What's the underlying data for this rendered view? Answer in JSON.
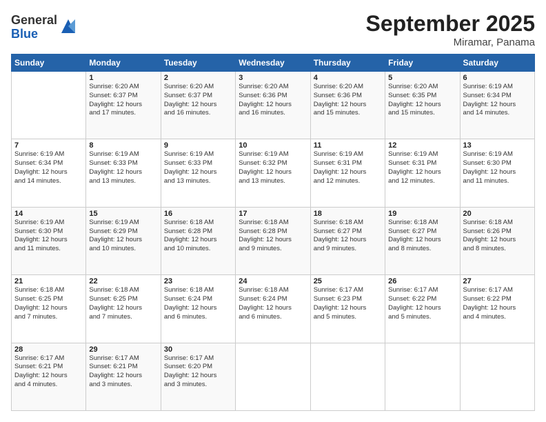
{
  "logo": {
    "general": "General",
    "blue": "Blue"
  },
  "header": {
    "month": "September 2025",
    "location": "Miramar, Panama"
  },
  "weekdays": [
    "Sunday",
    "Monday",
    "Tuesday",
    "Wednesday",
    "Thursday",
    "Friday",
    "Saturday"
  ],
  "weeks": [
    [
      {
        "num": "",
        "lines": []
      },
      {
        "num": "1",
        "lines": [
          "Sunrise: 6:20 AM",
          "Sunset: 6:37 PM",
          "Daylight: 12 hours",
          "and 17 minutes."
        ]
      },
      {
        "num": "2",
        "lines": [
          "Sunrise: 6:20 AM",
          "Sunset: 6:37 PM",
          "Daylight: 12 hours",
          "and 16 minutes."
        ]
      },
      {
        "num": "3",
        "lines": [
          "Sunrise: 6:20 AM",
          "Sunset: 6:36 PM",
          "Daylight: 12 hours",
          "and 16 minutes."
        ]
      },
      {
        "num": "4",
        "lines": [
          "Sunrise: 6:20 AM",
          "Sunset: 6:36 PM",
          "Daylight: 12 hours",
          "and 15 minutes."
        ]
      },
      {
        "num": "5",
        "lines": [
          "Sunrise: 6:20 AM",
          "Sunset: 6:35 PM",
          "Daylight: 12 hours",
          "and 15 minutes."
        ]
      },
      {
        "num": "6",
        "lines": [
          "Sunrise: 6:19 AM",
          "Sunset: 6:34 PM",
          "Daylight: 12 hours",
          "and 14 minutes."
        ]
      }
    ],
    [
      {
        "num": "7",
        "lines": [
          "Sunrise: 6:19 AM",
          "Sunset: 6:34 PM",
          "Daylight: 12 hours",
          "and 14 minutes."
        ]
      },
      {
        "num": "8",
        "lines": [
          "Sunrise: 6:19 AM",
          "Sunset: 6:33 PM",
          "Daylight: 12 hours",
          "and 13 minutes."
        ]
      },
      {
        "num": "9",
        "lines": [
          "Sunrise: 6:19 AM",
          "Sunset: 6:33 PM",
          "Daylight: 12 hours",
          "and 13 minutes."
        ]
      },
      {
        "num": "10",
        "lines": [
          "Sunrise: 6:19 AM",
          "Sunset: 6:32 PM",
          "Daylight: 12 hours",
          "and 13 minutes."
        ]
      },
      {
        "num": "11",
        "lines": [
          "Sunrise: 6:19 AM",
          "Sunset: 6:31 PM",
          "Daylight: 12 hours",
          "and 12 minutes."
        ]
      },
      {
        "num": "12",
        "lines": [
          "Sunrise: 6:19 AM",
          "Sunset: 6:31 PM",
          "Daylight: 12 hours",
          "and 12 minutes."
        ]
      },
      {
        "num": "13",
        "lines": [
          "Sunrise: 6:19 AM",
          "Sunset: 6:30 PM",
          "Daylight: 12 hours",
          "and 11 minutes."
        ]
      }
    ],
    [
      {
        "num": "14",
        "lines": [
          "Sunrise: 6:19 AM",
          "Sunset: 6:30 PM",
          "Daylight: 12 hours",
          "and 11 minutes."
        ]
      },
      {
        "num": "15",
        "lines": [
          "Sunrise: 6:19 AM",
          "Sunset: 6:29 PM",
          "Daylight: 12 hours",
          "and 10 minutes."
        ]
      },
      {
        "num": "16",
        "lines": [
          "Sunrise: 6:18 AM",
          "Sunset: 6:28 PM",
          "Daylight: 12 hours",
          "and 10 minutes."
        ]
      },
      {
        "num": "17",
        "lines": [
          "Sunrise: 6:18 AM",
          "Sunset: 6:28 PM",
          "Daylight: 12 hours",
          "and 9 minutes."
        ]
      },
      {
        "num": "18",
        "lines": [
          "Sunrise: 6:18 AM",
          "Sunset: 6:27 PM",
          "Daylight: 12 hours",
          "and 9 minutes."
        ]
      },
      {
        "num": "19",
        "lines": [
          "Sunrise: 6:18 AM",
          "Sunset: 6:27 PM",
          "Daylight: 12 hours",
          "and 8 minutes."
        ]
      },
      {
        "num": "20",
        "lines": [
          "Sunrise: 6:18 AM",
          "Sunset: 6:26 PM",
          "Daylight: 12 hours",
          "and 8 minutes."
        ]
      }
    ],
    [
      {
        "num": "21",
        "lines": [
          "Sunrise: 6:18 AM",
          "Sunset: 6:25 PM",
          "Daylight: 12 hours",
          "and 7 minutes."
        ]
      },
      {
        "num": "22",
        "lines": [
          "Sunrise: 6:18 AM",
          "Sunset: 6:25 PM",
          "Daylight: 12 hours",
          "and 7 minutes."
        ]
      },
      {
        "num": "23",
        "lines": [
          "Sunrise: 6:18 AM",
          "Sunset: 6:24 PM",
          "Daylight: 12 hours",
          "and 6 minutes."
        ]
      },
      {
        "num": "24",
        "lines": [
          "Sunrise: 6:18 AM",
          "Sunset: 6:24 PM",
          "Daylight: 12 hours",
          "and 6 minutes."
        ]
      },
      {
        "num": "25",
        "lines": [
          "Sunrise: 6:17 AM",
          "Sunset: 6:23 PM",
          "Daylight: 12 hours",
          "and 5 minutes."
        ]
      },
      {
        "num": "26",
        "lines": [
          "Sunrise: 6:17 AM",
          "Sunset: 6:22 PM",
          "Daylight: 12 hours",
          "and 5 minutes."
        ]
      },
      {
        "num": "27",
        "lines": [
          "Sunrise: 6:17 AM",
          "Sunset: 6:22 PM",
          "Daylight: 12 hours",
          "and 4 minutes."
        ]
      }
    ],
    [
      {
        "num": "28",
        "lines": [
          "Sunrise: 6:17 AM",
          "Sunset: 6:21 PM",
          "Daylight: 12 hours",
          "and 4 minutes."
        ]
      },
      {
        "num": "29",
        "lines": [
          "Sunrise: 6:17 AM",
          "Sunset: 6:21 PM",
          "Daylight: 12 hours",
          "and 3 minutes."
        ]
      },
      {
        "num": "30",
        "lines": [
          "Sunrise: 6:17 AM",
          "Sunset: 6:20 PM",
          "Daylight: 12 hours",
          "and 3 minutes."
        ]
      },
      {
        "num": "",
        "lines": []
      },
      {
        "num": "",
        "lines": []
      },
      {
        "num": "",
        "lines": []
      },
      {
        "num": "",
        "lines": []
      }
    ]
  ]
}
